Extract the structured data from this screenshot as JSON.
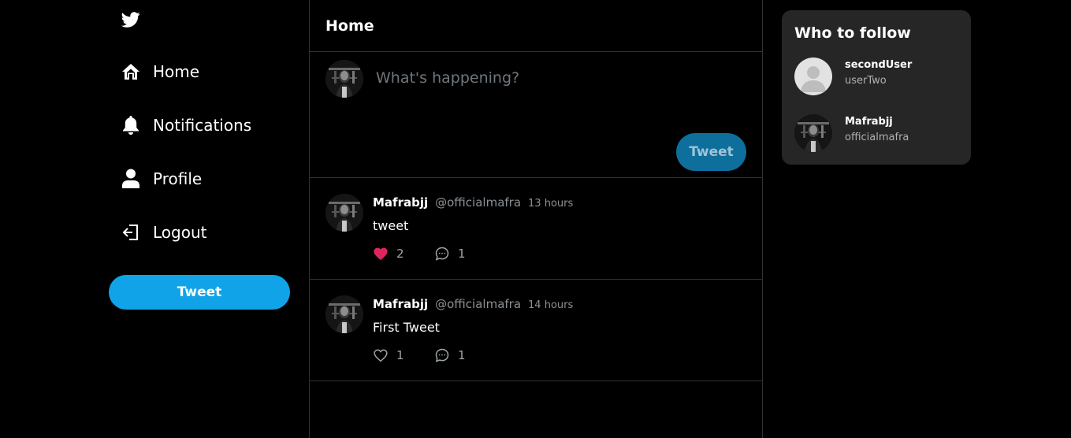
{
  "sidebar": {
    "logo_icon": "twitter-bird-icon",
    "nav": [
      {
        "label": "Home",
        "icon": "home-icon"
      },
      {
        "label": "Notifications",
        "icon": "bell-icon"
      },
      {
        "label": "Profile",
        "icon": "person-icon"
      },
      {
        "label": "Logout",
        "icon": "logout-icon"
      }
    ],
    "tweet_button": "Tweet"
  },
  "main": {
    "title": "Home",
    "composer": {
      "placeholder": "What's happening?",
      "button": "Tweet"
    },
    "tweets": [
      {
        "name": "Mafrabjj",
        "handle": "@officialmafra",
        "time": "13 hours",
        "text": "tweet",
        "likes": "2",
        "liked": true,
        "comments": "1"
      },
      {
        "name": "Mafrabjj",
        "handle": "@officialmafra",
        "time": "14 hours",
        "text": "First Tweet",
        "likes": "1",
        "liked": false,
        "comments": "1"
      }
    ]
  },
  "who_to_follow": {
    "title": "Who to follow",
    "users": [
      {
        "name": "secondUser",
        "handle": "userTwo",
        "avatar": "default-avatar"
      },
      {
        "name": "Mafrabjj",
        "handle": "officialmafra",
        "avatar": "photo-avatar"
      }
    ]
  },
  "colors": {
    "background": "#000000",
    "accent": "#10a3e8",
    "like": "#e0245e",
    "card": "#262626",
    "border": "#2f3336"
  }
}
